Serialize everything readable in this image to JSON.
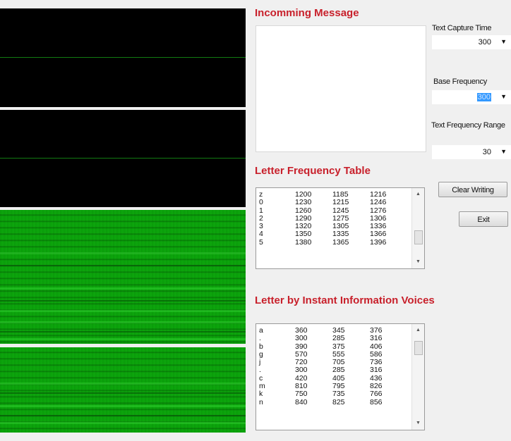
{
  "incoming_message": {
    "heading": "Incomming Message",
    "text": ""
  },
  "controls": {
    "text_capture_time": {
      "label": "Text Capture Time",
      "value": "300"
    },
    "base_frequency": {
      "label": "Base Frequency",
      "value": "300"
    },
    "text_frequency_range": {
      "label": "Text Frequency Range",
      "value": "30"
    },
    "clear_button": "Clear Writing",
    "exit_button": "Exit"
  },
  "letter_frequency_table": {
    "heading": "Letter Frequency Table",
    "rows": [
      [
        "z",
        "1200",
        "1185",
        "1216"
      ],
      [
        "0",
        "1230",
        "1215",
        "1246"
      ],
      [
        "1",
        "1260",
        "1245",
        "1276"
      ],
      [
        "2",
        "1290",
        "1275",
        "1306"
      ],
      [
        "3",
        "1320",
        "1305",
        "1336"
      ],
      [
        "4",
        "1350",
        "1335",
        "1366"
      ],
      [
        "5",
        "1380",
        "1365",
        "1396"
      ]
    ]
  },
  "instant_voices": {
    "heading": "Letter by Instant Information Voices",
    "rows": [
      [
        "a",
        "360",
        "345",
        "376"
      ],
      [
        ".",
        "300",
        "285",
        "316"
      ],
      [
        "b",
        "390",
        "375",
        "406"
      ],
      [
        "g",
        "570",
        "555",
        "586"
      ],
      [
        "j",
        "720",
        "705",
        "736"
      ],
      [
        ".",
        "300",
        "285",
        "316"
      ],
      [
        "c",
        "420",
        "405",
        "436"
      ],
      [
        "m",
        "810",
        "795",
        "826"
      ],
      [
        "k",
        "750",
        "735",
        "766"
      ],
      [
        "n",
        "840",
        "825",
        "856"
      ]
    ]
  },
  "icons": {
    "dropdown": "chevron-down-icon",
    "scroll_up": "scroll-up-arrow-icon",
    "scroll_down": "scroll-down-arrow-icon"
  },
  "colors": {
    "heading": "#c8202b",
    "spectrum_black": "#000000",
    "spectrum_green": "#0ba40b",
    "selection": "#3399ff"
  }
}
